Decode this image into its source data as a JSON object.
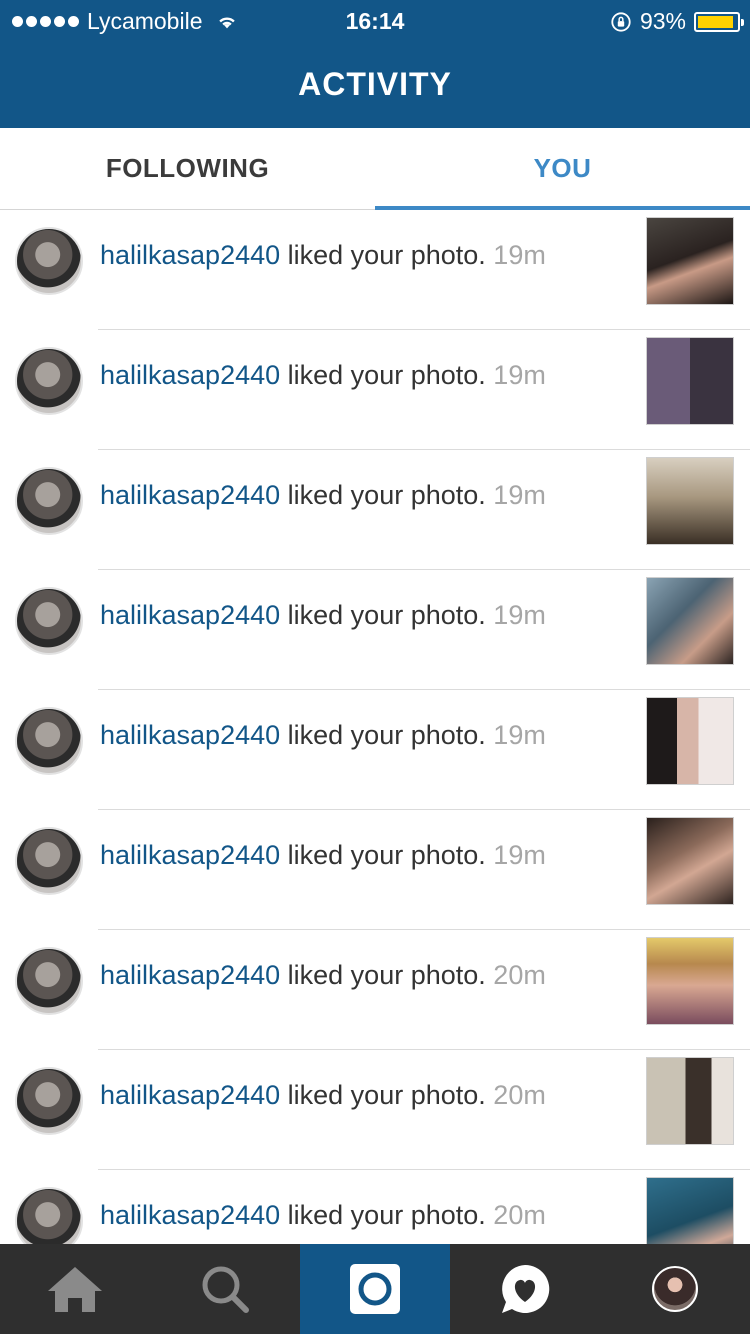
{
  "status_bar": {
    "carrier": "Lycamobile",
    "time": "16:14",
    "battery_percent": "93%",
    "battery_level": 0.93
  },
  "header": {
    "title": "ACTIVITY"
  },
  "tabs": [
    {
      "label": "FOLLOWING",
      "active": false
    },
    {
      "label": "YOU",
      "active": true
    }
  ],
  "activity": [
    {
      "user": "halilkasap2440",
      "action": "liked your photo.",
      "time": "19m"
    },
    {
      "user": "halilkasap2440",
      "action": "liked your photo.",
      "time": "19m"
    },
    {
      "user": "halilkasap2440",
      "action": "liked your photo.",
      "time": "19m"
    },
    {
      "user": "halilkasap2440",
      "action": "liked your photo.",
      "time": "19m"
    },
    {
      "user": "halilkasap2440",
      "action": "liked your photo.",
      "time": "19m"
    },
    {
      "user": "halilkasap2440",
      "action": "liked your photo.",
      "time": "19m"
    },
    {
      "user": "halilkasap2440",
      "action": "liked your photo.",
      "time": "20m"
    },
    {
      "user": "halilkasap2440",
      "action": "liked your photo.",
      "time": "20m"
    },
    {
      "user": "halilkasap2440",
      "action": "liked your photo.",
      "time": "20m"
    }
  ],
  "bottom_nav": [
    {
      "icon": "home-icon"
    },
    {
      "icon": "search-icon"
    },
    {
      "icon": "camera-icon",
      "active": true
    },
    {
      "icon": "activity-heart-icon"
    },
    {
      "icon": "profile-icon"
    }
  ],
  "colors": {
    "brand_blue": "#125688",
    "tab_active": "#3d89c6",
    "timestamp_gray": "#a6a6a6",
    "bottom_bar": "#2f2f2f"
  }
}
